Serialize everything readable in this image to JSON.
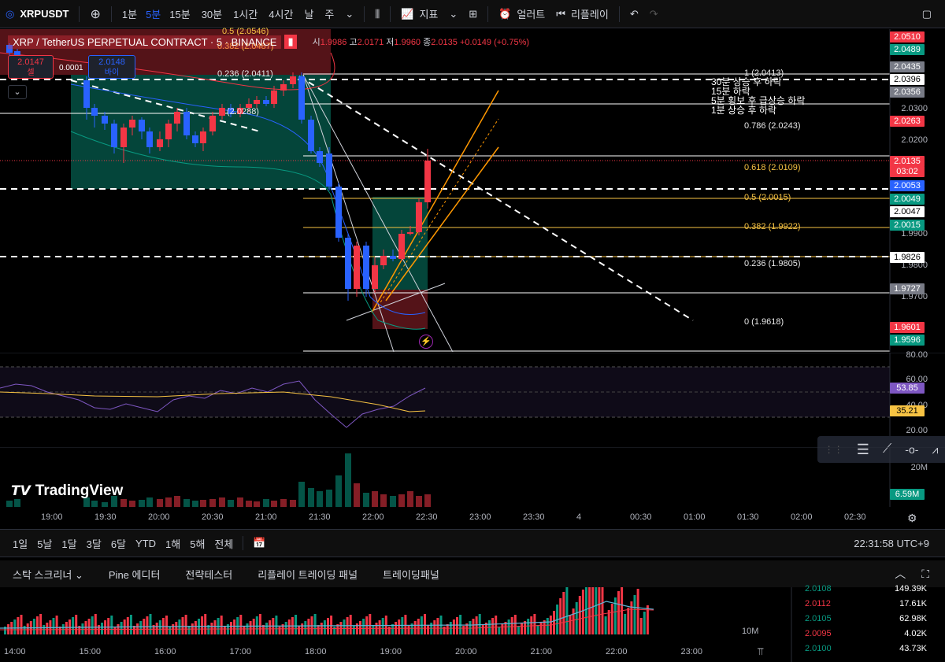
{
  "toolbar": {
    "symbol": "XRPUSDT",
    "add_label": "+",
    "intervals": [
      "1분",
      "5분",
      "15분",
      "30분",
      "1시간",
      "4시간",
      "날",
      "주"
    ],
    "active_interval": "5분",
    "indicators_label": "지표",
    "alert_label": "얼러트",
    "replay_label": "리플레이"
  },
  "legend": {
    "title": "XRP / TetherUS PERPETUAL CONTRACT · 5 · BINANCE",
    "open_label": "시",
    "open": "1.9986",
    "high_label": "고",
    "high": "2.0171",
    "low_label": "저",
    "low": "1.9960",
    "close_label": "종",
    "close": "2.0135",
    "change": "+0.0149 (+0.75%)"
  },
  "trade": {
    "sell_price": "2.0147",
    "sell_label": "셀",
    "spread": "0.0001",
    "buy_price": "2.0148",
    "buy_label": "바이"
  },
  "fib_labels": [
    {
      "text": "0.5 (2.0546)"
    },
    {
      "text": "0.382 (2.0487)"
    },
    {
      "text": "0.236 (2.0411)"
    },
    {
      "text": "(2.0288)"
    },
    {
      "text": "1 (2.0413)"
    },
    {
      "text": "0.786 (2.0243)"
    },
    {
      "text": "0.618 (2.0109)"
    },
    {
      "text": "0.5 (2.0015)"
    },
    {
      "text": "0.382 (1.9922)"
    },
    {
      "text": "0.236 (1.9805)"
    },
    {
      "text": "0 (1.9618)"
    }
  ],
  "notes": [
    "30분 상승 후 하락",
    "15분 하락",
    "5분 횡보 후 급상승 하락",
    "1분 상승 후 하락"
  ],
  "price_axis": {
    "ticks": [
      "2.0300",
      "2.0200",
      "1.9900",
      "1.9800",
      "1.9700"
    ],
    "labels": [
      {
        "v": "2.0510",
        "bg": "#f23645",
        "fg": "#fff"
      },
      {
        "v": "2.0489",
        "bg": "#089981",
        "fg": "#fff"
      },
      {
        "v": "2.0435",
        "bg": "#787b86",
        "fg": "#fff"
      },
      {
        "v": "2.0396",
        "bg": "#fff",
        "fg": "#000"
      },
      {
        "v": "2.0356",
        "bg": "#787b86",
        "fg": "#fff"
      },
      {
        "v": "2.0263",
        "bg": "#f23645",
        "fg": "#fff"
      },
      {
        "v": "2.0135",
        "bg": "#f23645",
        "fg": "#fff"
      },
      {
        "v": "03:02",
        "bg": "#f23645",
        "fg": "#fff"
      },
      {
        "v": "2.0053",
        "bg": "#2962ff",
        "fg": "#fff"
      },
      {
        "v": "2.0049",
        "bg": "#089981",
        "fg": "#fff"
      },
      {
        "v": "2.0047",
        "bg": "#fff",
        "fg": "#000"
      },
      {
        "v": "2.0015",
        "bg": "#089981",
        "fg": "#fff"
      },
      {
        "v": "1.9826",
        "bg": "#fff",
        "fg": "#000"
      },
      {
        "v": "1.9727",
        "bg": "#787b86",
        "fg": "#fff"
      },
      {
        "v": "1.9601",
        "bg": "#f23645",
        "fg": "#fff"
      },
      {
        "v": "1.9596",
        "bg": "#089981",
        "fg": "#fff"
      }
    ]
  },
  "rsi_axis": {
    "ticks": [
      "80.00",
      "60.00",
      "40.00",
      "20.00"
    ],
    "rsi_value": "53.85",
    "ma_value": "35.21"
  },
  "volume_axis": {
    "tick": "20M",
    "value": "6.59M"
  },
  "time_axis": [
    "19:00",
    "19:30",
    "20:00",
    "20:30",
    "21:00",
    "21:30",
    "22:00",
    "22:30",
    "23:00",
    "23:30",
    "4",
    "00:30",
    "01:00",
    "01:30",
    "02:00",
    "02:30"
  ],
  "watermark": "TradingView",
  "ranges": [
    "1일",
    "5날",
    "1달",
    "3달",
    "6달",
    "YTD",
    "1해",
    "5해",
    "전체"
  ],
  "clock": "22:31:58 UTC+9",
  "panels": [
    "스탁 스크리너",
    "Pine 에디터",
    "전략테스터",
    "리플레이 트레이딩 패널",
    "트레이딩패널"
  ],
  "bottom": {
    "time_ticks": [
      "14:00",
      "15:00",
      "16:00",
      "17:00",
      "18:00",
      "19:00",
      "20:00",
      "21:00",
      "22:00",
      "23:00"
    ],
    "axis_tick": "10M",
    "trades": [
      {
        "price": "2.0108",
        "size": "149.39K",
        "color": "#089981"
      },
      {
        "price": "2.0112",
        "size": "17.61K",
        "color": "#f23645"
      },
      {
        "price": "2.0105",
        "size": "62.98K",
        "color": "#089981"
      },
      {
        "price": "2.0095",
        "size": "4.02K",
        "color": "#f23645"
      },
      {
        "price": "2.0100",
        "size": "43.73K",
        "color": "#089981"
      }
    ]
  }
}
